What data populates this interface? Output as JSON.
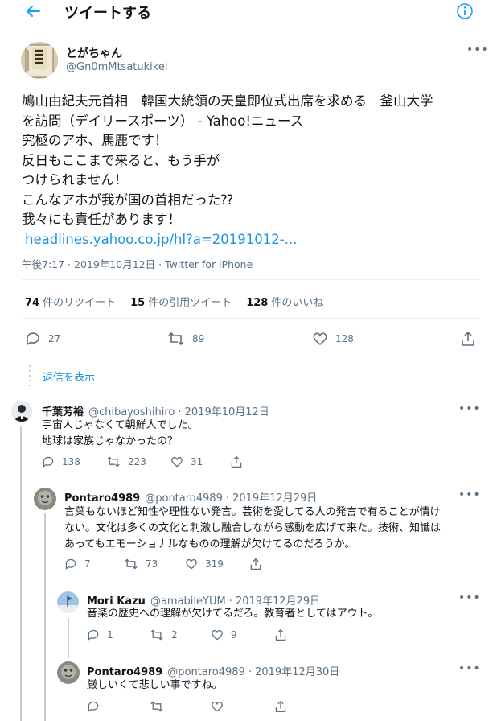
{
  "header": {
    "title": "ツイートする"
  },
  "main_tweet": {
    "author_name": "とがちゃん",
    "author_handle": "@Gn0mMtsatukikei",
    "text_lines": [
      "鳩山由紀夫元首相　韓国大統領の天皇即位式出席を求める　釜山大学",
      "を訪問（デイリースポーツ） - Yahoo!ニュース",
      "究極のアホ、馬鹿です！",
      "反日もここまで来ると、もう手が",
      "つけられません！",
      "こんなアホが我が国の首相だった⁇",
      "我々にも責任があります！"
    ],
    "link": "headlines.yahoo.co.jp/hl?a=20191012-...",
    "meta": "午後7:17 · 2019年10月12日 · Twitter for iPhone",
    "stats": {
      "retweets_count": "74",
      "retweets_label": "件のリツイート",
      "quotes_count": "15",
      "quotes_label": "件の引用ツイート",
      "likes_count": "128",
      "likes_label": "件のいいね"
    },
    "actions": {
      "reply": "27",
      "retweet": "89",
      "like": "128"
    }
  },
  "show_replies": "返信を表示",
  "replies": [
    {
      "name": "千葉芳裕",
      "handle": "@chibayoshihiro",
      "date": "· 2019年10月12日",
      "lines": [
        "宇宙人じゃなくて朝鮮人でした。",
        "地球は家族じゃなかったの？"
      ],
      "reply": "138",
      "retweet": "223",
      "like": "31"
    },
    {
      "name": "Pontaro4989",
      "handle": "@pontaro4989",
      "date": "· 2019年12月29日",
      "lines": [
        "言葉もないほど知性や理性ない発言。芸術を愛してる人の発言で有ることが情け",
        "ない。文化は多くの文化と刺激し融合しながら感動を広げて来た。技術、知識は",
        "あってもエモーショナルなものの理解が欠けてるのだろうか。"
      ],
      "reply": "7",
      "retweet": "73",
      "like": "319"
    },
    {
      "name": "Mori Kazu",
      "handle": "@amabileYUM",
      "date": "· 2019年12月29日",
      "lines": [
        "音楽の歴史への理解が欠けてるだろ。教育者としてはアウト。"
      ],
      "reply": "1",
      "retweet": "2",
      "like": "9"
    },
    {
      "name": "Pontaro4989",
      "handle": "@pontaro4989",
      "date": "· 2019年12月30日",
      "lines": [
        "厳しいくて悲しい事ですね。"
      ],
      "reply": "",
      "retweet": "",
      "like": ""
    }
  ],
  "colors": {
    "accent": "#1da1f2",
    "muted": "#5b7083",
    "divider": "#ebeef0"
  }
}
